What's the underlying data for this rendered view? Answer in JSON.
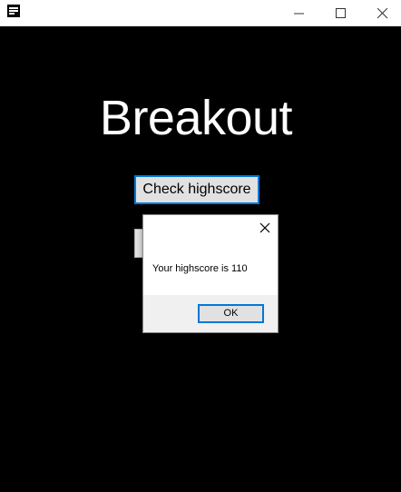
{
  "window": {
    "icon": "app-window-icon",
    "controls": {
      "minimize_icon": "minimize-icon",
      "maximize_icon": "maximize-icon",
      "close_icon": "close-icon"
    }
  },
  "main": {
    "title": "Breakout",
    "check_highscore_label": "Check highscore"
  },
  "dialog": {
    "message": "Your highscore is 110",
    "ok_label": "OK",
    "close_icon": "close-icon"
  },
  "colors": {
    "background": "#000000",
    "accent": "#0078d7",
    "button_face": "#e1e1e1"
  }
}
